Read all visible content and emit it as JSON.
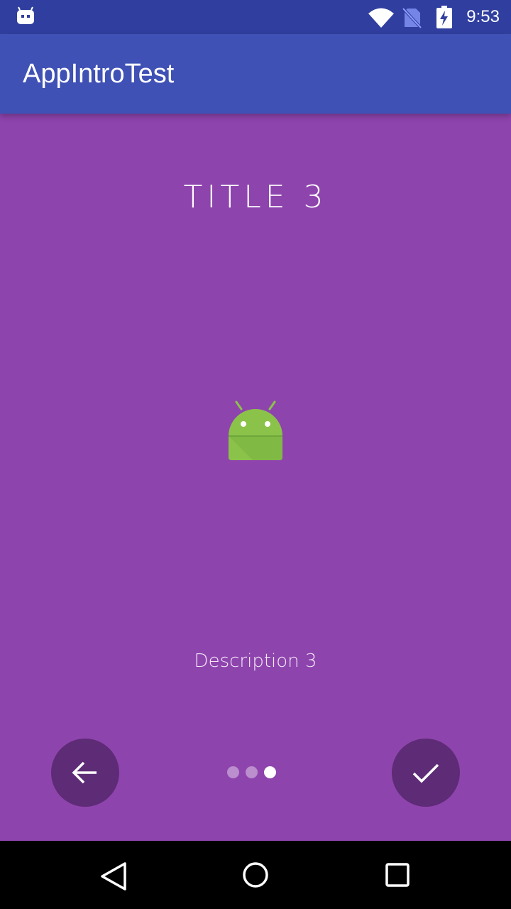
{
  "status_bar": {
    "time": "9:53",
    "icons": [
      "android-debug-icon",
      "wifi-icon",
      "no-sim-icon",
      "battery-charging-icon"
    ]
  },
  "app_bar": {
    "title": "AppIntroTest",
    "color": "#3f51b5",
    "status_color": "#303f9f"
  },
  "slide": {
    "title": "TITLE 3",
    "description": "Description 3",
    "image": "android-robot-icon",
    "background": "#8e44ad"
  },
  "controls": {
    "back_icon": "arrow-left-icon",
    "done_icon": "checkmark-icon",
    "button_color": "#5e2b76"
  },
  "indicator": {
    "total": 3,
    "active_index": 3
  },
  "nav_bar": {
    "icons": [
      "back-triangle-icon",
      "home-circle-icon",
      "recents-square-icon"
    ]
  }
}
